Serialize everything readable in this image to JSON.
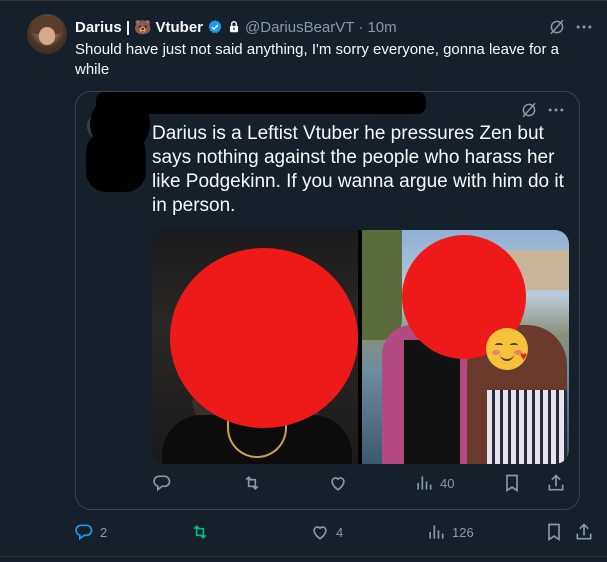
{
  "tweet": {
    "display_name": "Darius |",
    "name_emoji": "🐻",
    "name_suffix": "Vtuber",
    "handle": "@DariusBearVT",
    "separator": "·",
    "time": "10m",
    "text": "Should have just not said anything, I'm sorry everyone, gonna leave for a while"
  },
  "quoted_tweet": {
    "text": "Darius is a Leftist Vtuber he pressures Zen but says nothing against the people who harass her like Podgekinn. If you wanna argue with him do it in person.",
    "actions": {
      "reply_count": "",
      "repost_count": "",
      "like_count": "",
      "views_count": "40"
    }
  },
  "actions": {
    "reply_count": "2",
    "repost_count": "",
    "like_count": "4",
    "views_count": "126"
  },
  "colors": {
    "background": "#15202b",
    "text": "#f7f9f9",
    "muted": "#8b98a5",
    "accent": "#1d9bf0",
    "redaction": "#ee1a1a"
  },
  "icons": [
    "verified-badge-icon",
    "lock-icon",
    "grok-icon",
    "more-icon",
    "reply-icon",
    "repost-icon",
    "like-icon",
    "views-icon",
    "bookmark-icon",
    "share-icon"
  ]
}
